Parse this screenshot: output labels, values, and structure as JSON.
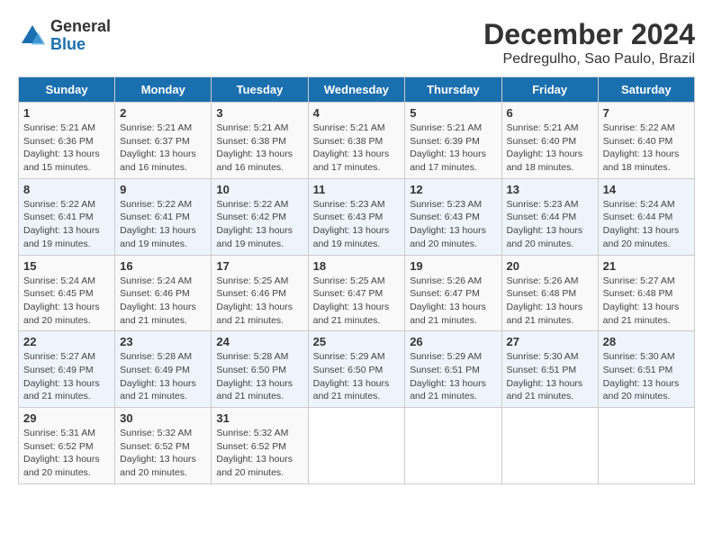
{
  "header": {
    "logo_general": "General",
    "logo_blue": "Blue",
    "month": "December 2024",
    "location": "Pedregulho, Sao Paulo, Brazil"
  },
  "days_of_week": [
    "Sunday",
    "Monday",
    "Tuesday",
    "Wednesday",
    "Thursday",
    "Friday",
    "Saturday"
  ],
  "weeks": [
    [
      {
        "day": 1,
        "info": "Sunrise: 5:21 AM\nSunset: 6:36 PM\nDaylight: 13 hours and 15 minutes."
      },
      {
        "day": 2,
        "info": "Sunrise: 5:21 AM\nSunset: 6:37 PM\nDaylight: 13 hours and 16 minutes."
      },
      {
        "day": 3,
        "info": "Sunrise: 5:21 AM\nSunset: 6:38 PM\nDaylight: 13 hours and 16 minutes."
      },
      {
        "day": 4,
        "info": "Sunrise: 5:21 AM\nSunset: 6:38 PM\nDaylight: 13 hours and 17 minutes."
      },
      {
        "day": 5,
        "info": "Sunrise: 5:21 AM\nSunset: 6:39 PM\nDaylight: 13 hours and 17 minutes."
      },
      {
        "day": 6,
        "info": "Sunrise: 5:21 AM\nSunset: 6:40 PM\nDaylight: 13 hours and 18 minutes."
      },
      {
        "day": 7,
        "info": "Sunrise: 5:22 AM\nSunset: 6:40 PM\nDaylight: 13 hours and 18 minutes."
      }
    ],
    [
      {
        "day": 8,
        "info": "Sunrise: 5:22 AM\nSunset: 6:41 PM\nDaylight: 13 hours and 19 minutes."
      },
      {
        "day": 9,
        "info": "Sunrise: 5:22 AM\nSunset: 6:41 PM\nDaylight: 13 hours and 19 minutes."
      },
      {
        "day": 10,
        "info": "Sunrise: 5:22 AM\nSunset: 6:42 PM\nDaylight: 13 hours and 19 minutes."
      },
      {
        "day": 11,
        "info": "Sunrise: 5:23 AM\nSunset: 6:43 PM\nDaylight: 13 hours and 19 minutes."
      },
      {
        "day": 12,
        "info": "Sunrise: 5:23 AM\nSunset: 6:43 PM\nDaylight: 13 hours and 20 minutes."
      },
      {
        "day": 13,
        "info": "Sunrise: 5:23 AM\nSunset: 6:44 PM\nDaylight: 13 hours and 20 minutes."
      },
      {
        "day": 14,
        "info": "Sunrise: 5:24 AM\nSunset: 6:44 PM\nDaylight: 13 hours and 20 minutes."
      }
    ],
    [
      {
        "day": 15,
        "info": "Sunrise: 5:24 AM\nSunset: 6:45 PM\nDaylight: 13 hours and 20 minutes."
      },
      {
        "day": 16,
        "info": "Sunrise: 5:24 AM\nSunset: 6:46 PM\nDaylight: 13 hours and 21 minutes."
      },
      {
        "day": 17,
        "info": "Sunrise: 5:25 AM\nSunset: 6:46 PM\nDaylight: 13 hours and 21 minutes."
      },
      {
        "day": 18,
        "info": "Sunrise: 5:25 AM\nSunset: 6:47 PM\nDaylight: 13 hours and 21 minutes."
      },
      {
        "day": 19,
        "info": "Sunrise: 5:26 AM\nSunset: 6:47 PM\nDaylight: 13 hours and 21 minutes."
      },
      {
        "day": 20,
        "info": "Sunrise: 5:26 AM\nSunset: 6:48 PM\nDaylight: 13 hours and 21 minutes."
      },
      {
        "day": 21,
        "info": "Sunrise: 5:27 AM\nSunset: 6:48 PM\nDaylight: 13 hours and 21 minutes."
      }
    ],
    [
      {
        "day": 22,
        "info": "Sunrise: 5:27 AM\nSunset: 6:49 PM\nDaylight: 13 hours and 21 minutes."
      },
      {
        "day": 23,
        "info": "Sunrise: 5:28 AM\nSunset: 6:49 PM\nDaylight: 13 hours and 21 minutes."
      },
      {
        "day": 24,
        "info": "Sunrise: 5:28 AM\nSunset: 6:50 PM\nDaylight: 13 hours and 21 minutes."
      },
      {
        "day": 25,
        "info": "Sunrise: 5:29 AM\nSunset: 6:50 PM\nDaylight: 13 hours and 21 minutes."
      },
      {
        "day": 26,
        "info": "Sunrise: 5:29 AM\nSunset: 6:51 PM\nDaylight: 13 hours and 21 minutes."
      },
      {
        "day": 27,
        "info": "Sunrise: 5:30 AM\nSunset: 6:51 PM\nDaylight: 13 hours and 21 minutes."
      },
      {
        "day": 28,
        "info": "Sunrise: 5:30 AM\nSunset: 6:51 PM\nDaylight: 13 hours and 20 minutes."
      }
    ],
    [
      {
        "day": 29,
        "info": "Sunrise: 5:31 AM\nSunset: 6:52 PM\nDaylight: 13 hours and 20 minutes."
      },
      {
        "day": 30,
        "info": "Sunrise: 5:32 AM\nSunset: 6:52 PM\nDaylight: 13 hours and 20 minutes."
      },
      {
        "day": 31,
        "info": "Sunrise: 5:32 AM\nSunset: 6:52 PM\nDaylight: 13 hours and 20 minutes."
      },
      null,
      null,
      null,
      null
    ]
  ]
}
